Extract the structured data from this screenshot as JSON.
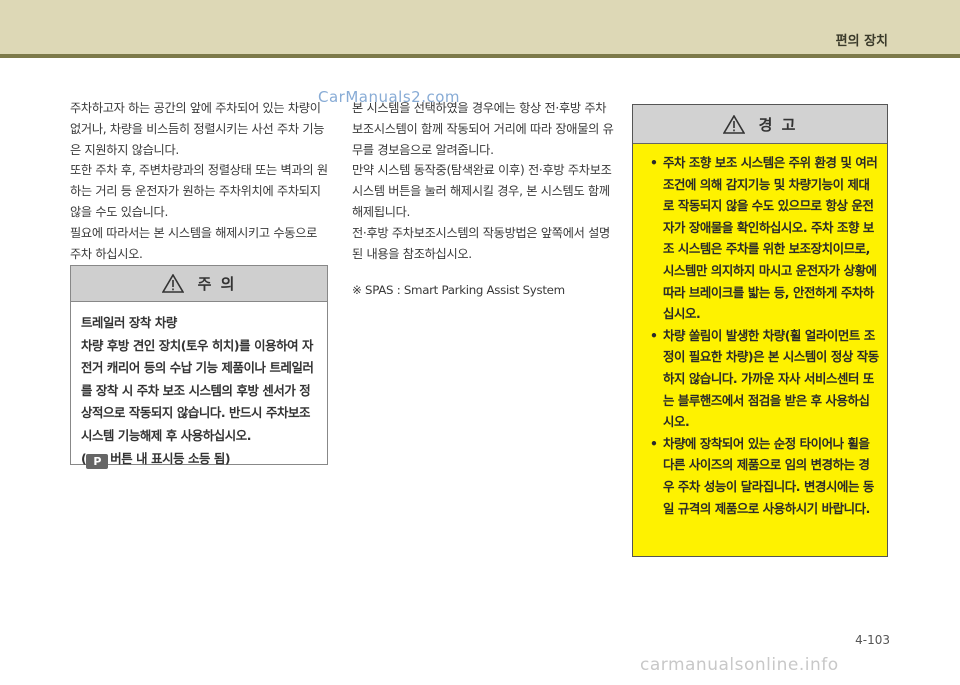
{
  "header": {
    "section_title": "편의 장치"
  },
  "watermarks": {
    "top": "CarManuals2.com",
    "bottom": "carmanualsonline.info"
  },
  "left_column": {
    "paragraphs": [
      "주차하고자 하는 공간의 앞에 주차되어 있는 차량이 없거나, 차량을 비스듬히 정렬시키는 사선 주차 기능은 지원하지 않습니다.",
      "또한 주차 후, 주변차량과의 정렬상태 또는 벽과의 원하는 거리 등 운전자가 원하는 주차위치에 주차되지 않을 수도 있습니다.",
      "필요에 따라서는 본 시스템을 해제시키고 수동으로 주차 하십시오."
    ]
  },
  "middle_column": {
    "paragraphs": [
      "본 시스템을 선택하였을 경우에는 항상 전·후방 주차보조시스템이 함께 작동되어 거리에 따라 장애물의 유무를 경보음으로 알려줍니다.",
      "만약 시스템 동작중(탐색완료 이후) 전·후방 주차보조 시스템 버튼을 눌러 해제시킬 경우, 본 시스템도 함께 해제됩니다.",
      "전·후방 주차보조시스템의 작동방법은 앞쪽에서 설명된 내용을 참조하십시오."
    ],
    "note": "※ SPAS : Smart Parking Assist System"
  },
  "caution": {
    "title": "주 의",
    "subtitle": "트레일러 장착 차량",
    "body": "차량 후방 견인 장치(토우 히치)를 이용하여 자전거 캐리어 등의 수납 기능 제품이나 트레일러를 장착 시 주차 보조 시스템의 후방 센서가 정상적으로 작동되지 않습니다. 반드시 주차보조시스템 기능해제 후 사용하십시오.",
    "icon_note_prefix": "(",
    "icon_label": "P",
    "icon_note": "버튼 내 표시등 소등 됨)"
  },
  "warning": {
    "title": "경 고",
    "items": [
      "주차 조향 보조 시스템은 주위 환경 및 여러 조건에 의해 감지기능 및 차량기능이 제대로 작동되지 않을 수도 있으므로 항상 운전자가 장애물을 확인하십시오. 주차 조향 보조 시스템은 주차를 위한 보조장치이므로, 시스템만 의지하지 마시고 운전자가 상황에 따라 브레이크를 밟는 등, 안전하게 주차하십시오.",
      "차량 쏠림이 발생한 차량(휠 얼라이먼트 조정이 필요한 차량)은 본 시스템이 정상 작동하지 않습니다. 가까운 자사 서비스센터 또는 블루핸즈에서 점검을 받은 후 사용하십시오.",
      "차량에 장착되어 있는 순정 타이어나 휠을 다른 사이즈의 제품으로 임의 변경하는 경우 주차 성능이 달라집니다. 변경시에는 동일 규격의 제품으로 사용하시기 바랍니다."
    ]
  },
  "footer": {
    "page_number": "4-103"
  },
  "colors": {
    "header_band": "#ddd8b6",
    "header_line": "#7d7a4a",
    "warning_bg": "#fef200"
  },
  "icons": {
    "caution": "warning-triangle-icon",
    "warning": "warning-triangle-icon"
  }
}
